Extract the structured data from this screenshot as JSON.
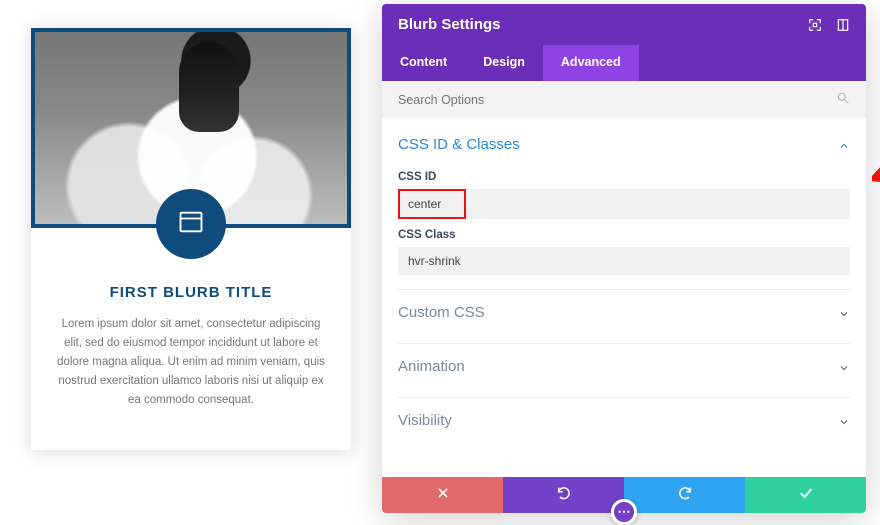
{
  "preview": {
    "blurb": {
      "title": "FIRST BLURB TITLE",
      "text": "Lorem ipsum dolor sit amet, consectetur adipiscing elit, sed do eiusmod tempor incididunt ut labore et dolore magna aliqua. Ut enim ad minim veniam, quis nostrud exercitation ullamco laboris nisi ut aliquip ex ea commodo consequat."
    }
  },
  "panel": {
    "title": "Blurb Settings",
    "tabs": {
      "content": "Content",
      "design": "Design",
      "advanced": "Advanced"
    },
    "active_tab": "advanced",
    "search_placeholder": "Search Options",
    "sections": {
      "css_id_classes": {
        "title": "CSS ID & Classes",
        "fields": {
          "css_id_label": "CSS ID",
          "css_id_value": "center",
          "css_class_label": "CSS Class",
          "css_class_value": "hvr-shrink"
        }
      },
      "custom_css": {
        "title": "Custom CSS"
      },
      "animation": {
        "title": "Animation"
      },
      "visibility": {
        "title": "Visibility"
      }
    }
  },
  "colors": {
    "accent_purple": "#6c2eb9",
    "accent_blue": "#2b87da",
    "highlight_red": "#e11"
  }
}
